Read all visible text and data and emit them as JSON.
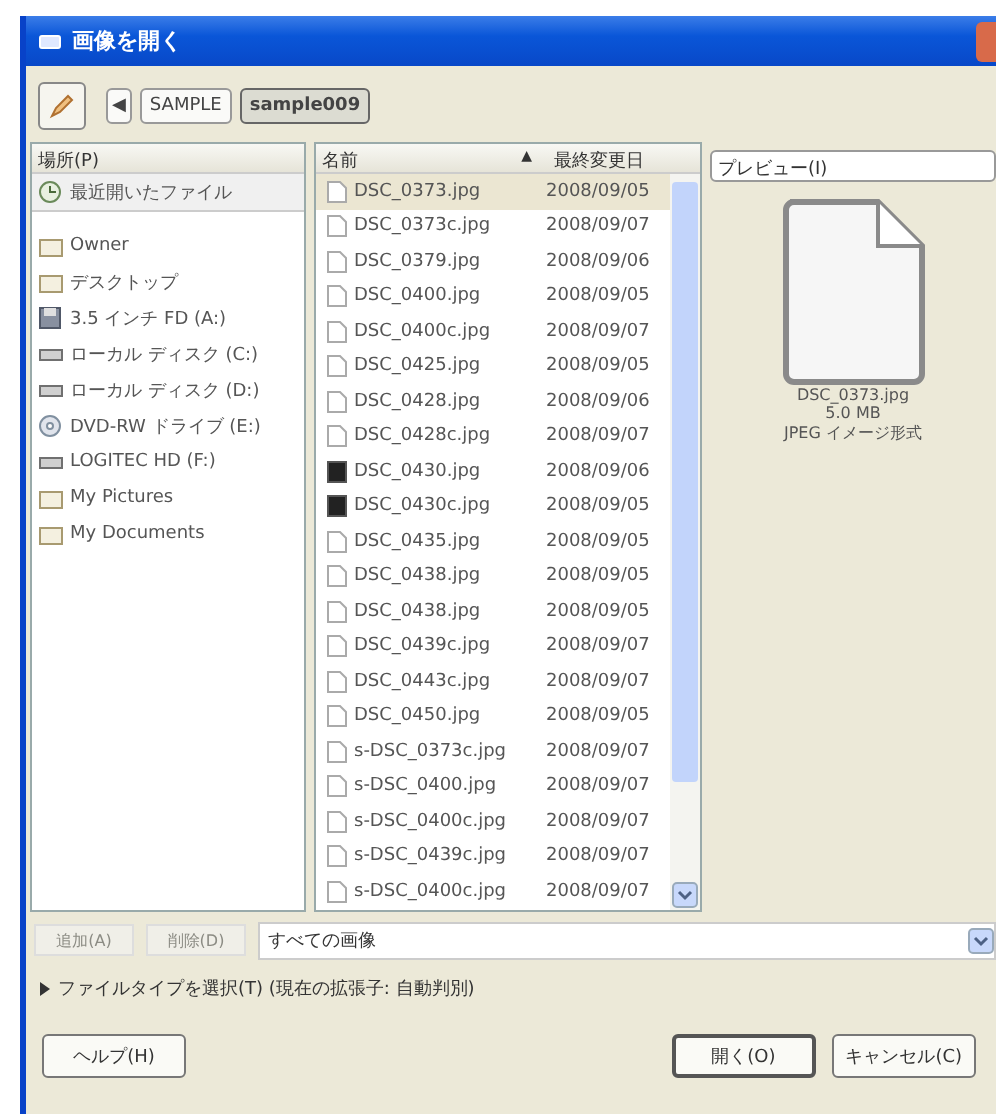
{
  "window": {
    "title": "画像を開く"
  },
  "path_bar": [
    {
      "label": "◀",
      "kind": "arrow"
    },
    {
      "label": "SAMPLE",
      "kind": "folder",
      "selected": false
    },
    {
      "label": "sample009",
      "kind": "folder",
      "selected": true
    }
  ],
  "places": {
    "header": "場所(P)",
    "items": [
      {
        "label": "最近開いたファイル",
        "kind": "recent",
        "selected": true
      },
      {
        "label": "Owner",
        "kind": "folder",
        "selected": false
      },
      {
        "label": "デスクトップ",
        "kind": "folder",
        "selected": false
      },
      {
        "label": "3.5 インチ FD (A:)",
        "kind": "floppy",
        "selected": false
      },
      {
        "label": "ローカル ディスク (C:)",
        "kind": "drive",
        "selected": false
      },
      {
        "label": "ローカル ディスク (D:)",
        "kind": "drive",
        "selected": false
      },
      {
        "label": "DVD-RW ドライブ (E:)",
        "kind": "cdrom",
        "selected": false
      },
      {
        "label": "LOGITEC HD (F:)",
        "kind": "drive",
        "selected": false
      },
      {
        "label": "My Pictures",
        "kind": "folder",
        "selected": false
      },
      {
        "label": "My Documents",
        "kind": "folder",
        "selected": false
      }
    ]
  },
  "files": {
    "columns": [
      {
        "label": "名前",
        "sort": "▲"
      },
      {
        "label": "最終変更日"
      }
    ],
    "rows": [
      {
        "name": "DSC_0373.jpg",
        "date": "2008/09/05",
        "kind": "file",
        "selected": true
      },
      {
        "name": "DSC_0373c.jpg",
        "date": "2008/09/07",
        "kind": "file",
        "selected": false
      },
      {
        "name": "DSC_0379.jpg",
        "date": "2008/09/06",
        "kind": "file",
        "selected": false
      },
      {
        "name": "DSC_0400.jpg",
        "date": "2008/09/05",
        "kind": "file",
        "selected": false
      },
      {
        "name": "DSC_0400c.jpg",
        "date": "2008/09/07",
        "kind": "file",
        "selected": false
      },
      {
        "name": "DSC_0425.jpg",
        "date": "2008/09/05",
        "kind": "file",
        "selected": false
      },
      {
        "name": "DSC_0428.jpg",
        "date": "2008/09/06",
        "kind": "file",
        "selected": false
      },
      {
        "name": "DSC_0428c.jpg",
        "date": "2008/09/07",
        "kind": "file",
        "selected": false
      },
      {
        "name": "DSC_0430.jpg",
        "date": "2008/09/06",
        "kind": "image",
        "selected": false
      },
      {
        "name": "DSC_0430c.jpg",
        "date": "2008/09/05",
        "kind": "image",
        "selected": false
      },
      {
        "name": "DSC_0435.jpg",
        "date": "2008/09/05",
        "kind": "file",
        "selected": false
      },
      {
        "name": "DSC_0438.jpg",
        "date": "2008/09/05",
        "kind": "file",
        "selected": false
      },
      {
        "name": "DSC_0438.jpg",
        "date": "2008/09/05",
        "kind": "file",
        "selected": false
      },
      {
        "name": "DSC_0439c.jpg",
        "date": "2008/09/07",
        "kind": "file",
        "selected": false
      },
      {
        "name": "DSC_0443c.jpg",
        "date": "2008/09/07",
        "kind": "file",
        "selected": false
      },
      {
        "name": "DSC_0450.jpg",
        "date": "2008/09/05",
        "kind": "file",
        "selected": false
      },
      {
        "name": "s-DSC_0373c.jpg",
        "date": "2008/09/07",
        "kind": "file",
        "selected": false
      },
      {
        "name": "s-DSC_0400.jpg",
        "date": "2008/09/07",
        "kind": "file",
        "selected": false
      },
      {
        "name": "s-DSC_0400c.jpg",
        "date": "2008/09/07",
        "kind": "file",
        "selected": false
      },
      {
        "name": "s-DSC_0439c.jpg",
        "date": "2008/09/07",
        "kind": "file",
        "selected": false
      },
      {
        "name": "s-DSC_0400c.jpg",
        "date": "2008/09/07",
        "kind": "file",
        "selected": false
      }
    ]
  },
  "preview": {
    "header": "プレビュー(I)",
    "filename": "DSC_0373.jpg",
    "size": "5.0 MB",
    "format": "JPEG イメージ形式"
  },
  "filter_row": {
    "buttons": [
      {
        "label": "追加(A)",
        "disabled": true
      },
      {
        "label": "削除(D)",
        "disabled": true
      }
    ],
    "filter": "すべての画像"
  },
  "expander": {
    "label": "ファイルタイプを選択(T)  (現在の拡張子: 自動判別)",
    "expanded": false
  },
  "buttons": [
    {
      "label": "ヘルプ(H)",
      "kind": "help"
    },
    {
      "label": "開く(O)",
      "kind": "default"
    },
    {
      "label": "キャンセル(C)",
      "kind": "normal"
    }
  ]
}
